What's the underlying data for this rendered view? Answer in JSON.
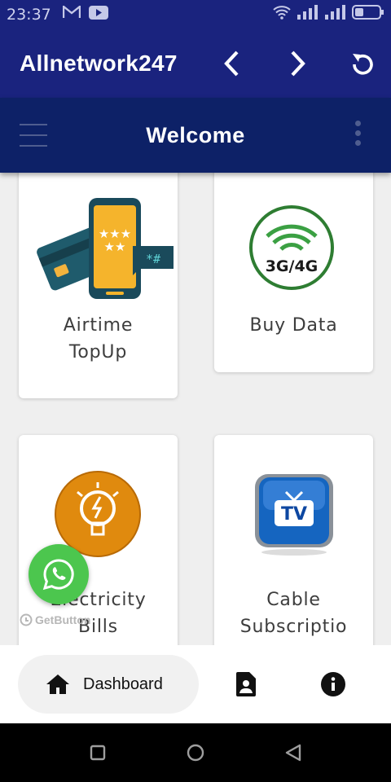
{
  "status_bar": {
    "time": "23:37"
  },
  "app_bar": {
    "title": "Allnetwork247"
  },
  "header": {
    "title": "Welcome"
  },
  "cards": [
    {
      "label_line1": "Airtime",
      "label_line2": "TopUp",
      "icon": "airtime-topup-icon"
    },
    {
      "label_line1": "Buy Data",
      "label_line2": "",
      "icon": "buy-data-icon",
      "badge": "3G/4G"
    },
    {
      "label_line1": "Electricity",
      "label_line2": "Bills",
      "icon": "electricity-bulb-icon"
    },
    {
      "label_line1": "Cable",
      "label_line2": "Subscriptio",
      "icon": "cable-tv-icon",
      "badge": "TV"
    }
  ],
  "whatsapp": {
    "watermark": "GetButton"
  },
  "bottom_nav": {
    "active_label": "Dashboard"
  },
  "colors": {
    "primary": "#1a237e",
    "header": "#0d2167",
    "whatsapp": "#4cc64e"
  }
}
